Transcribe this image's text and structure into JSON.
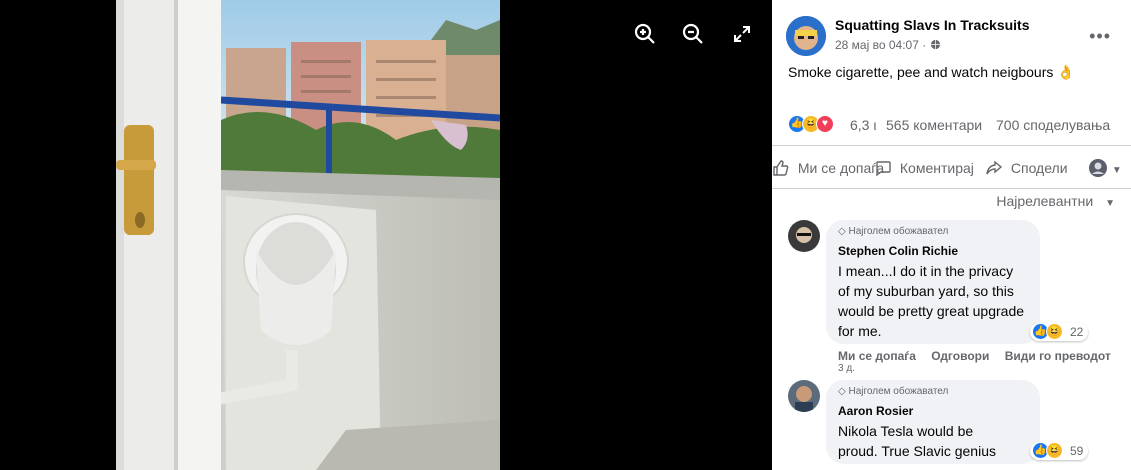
{
  "post": {
    "page_name": "Squatting Slavs In Tracksuits",
    "date": "28 мај во 04:07",
    "separator": "·",
    "text": "Smoke cigarette, pee and watch neigbours 👌",
    "reaction_count": "6,3 ι",
    "comments_count": "565 коментари",
    "shares_count": "700 споделувања"
  },
  "actions": {
    "like": "Ми се допаѓа",
    "comment": "Коментирај",
    "share": "Сподели"
  },
  "sort_label": "Најрелевантни",
  "comments": [
    {
      "badge": "Најголем обожавател",
      "name": "Stephen Colin Richie",
      "text": "I mean...I do it in the privacy of my suburban yard, so this would be pretty great upgrade for me.",
      "reactions": "22",
      "like": "Ми се допаѓа",
      "reply": "Одговори",
      "translate": "Види го преводот",
      "time": "3 д."
    },
    {
      "badge": "Најголем обожавател",
      "name": "Aaron Rosier",
      "text": "Nikola Tesla would be proud. True Slavic genius",
      "reactions": "59"
    }
  ],
  "colors": {
    "like_blue": "#1877f2",
    "haha_yellow": "#f7b928",
    "love_red": "#f33e58",
    "secondary_text": "#65676b"
  }
}
